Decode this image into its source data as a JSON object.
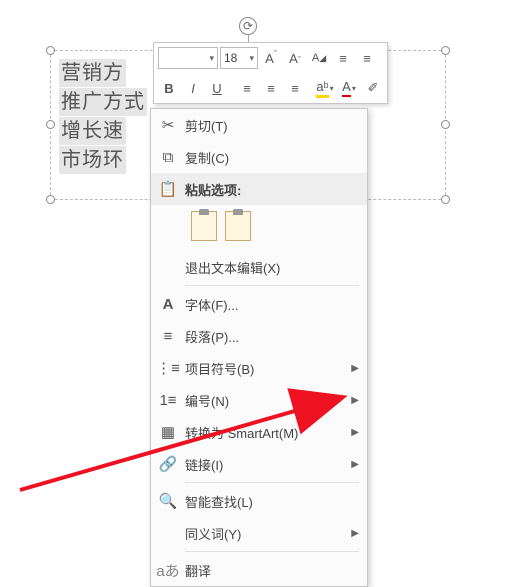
{
  "textbox": {
    "lines": [
      "营销方",
      "推广方式",
      "增长速",
      "市场环"
    ]
  },
  "minitoolbar": {
    "fontsize": "18",
    "btn_grow": "A",
    "btn_shrink": "A",
    "btn_bold": "B",
    "btn_italic": "I",
    "btn_underline": "U",
    "btn_highlight": "aᵇ",
    "btn_fontcolor": "A"
  },
  "context": {
    "cut": "剪切(T)",
    "copy": "复制(C)",
    "paste_header": "粘贴选项:",
    "exit_text": "退出文本编辑(X)",
    "font": "字体(F)...",
    "paragraph": "段落(P)...",
    "bullets": "项目符号(B)",
    "numbering": "编号(N)",
    "smartart": "转换为 SmartArt(M)",
    "link": "链接(I)",
    "smartlookup": "智能查找(L)",
    "synonyms": "同义词(Y)",
    "translate": "翻译"
  }
}
